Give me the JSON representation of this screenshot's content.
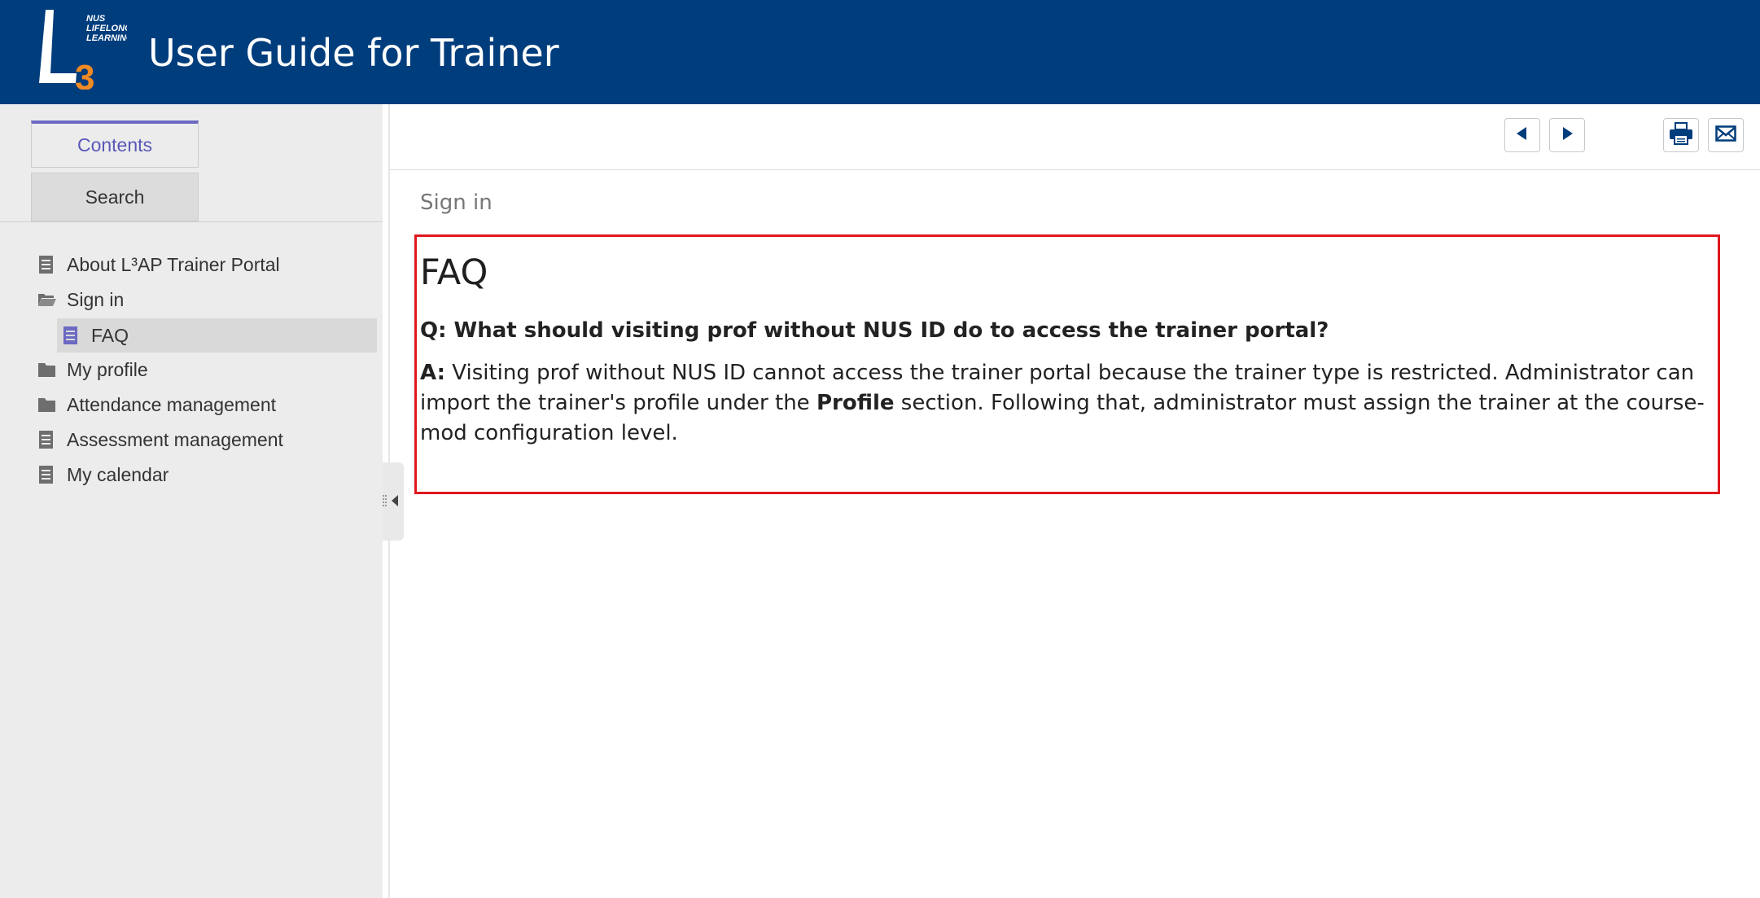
{
  "header": {
    "title": "User Guide for Trainer",
    "logo": {
      "big_letter": "L",
      "superscript": "3",
      "org_line1": "NUS",
      "org_line2": "LIFELONG",
      "org_line3": "LEARNING"
    }
  },
  "sidebar": {
    "tabs": [
      {
        "label": "Contents",
        "active": true
      },
      {
        "label": "Search",
        "active": false
      }
    ],
    "toc": [
      {
        "label": "About L³AP Trainer Portal",
        "icon": "page-icon",
        "level": 0
      },
      {
        "label": "Sign in",
        "icon": "folder-open-icon",
        "level": 0
      },
      {
        "label": "FAQ",
        "icon": "page-icon",
        "level": 1,
        "selected": true
      },
      {
        "label": "My profile",
        "icon": "folder-icon",
        "level": 0
      },
      {
        "label": "Attendance management",
        "icon": "folder-icon",
        "level": 0
      },
      {
        "label": "Assessment management",
        "icon": "page-icon",
        "level": 0
      },
      {
        "label": "My calendar",
        "icon": "page-icon",
        "level": 0
      }
    ]
  },
  "toolbar": {
    "buttons": [
      {
        "name": "previous-topic",
        "icon": "triangle-left-icon"
      },
      {
        "name": "next-topic",
        "icon": "triangle-right-icon"
      },
      {
        "name": "print",
        "icon": "printer-icon"
      },
      {
        "name": "email",
        "icon": "envelope-icon"
      }
    ]
  },
  "content": {
    "breadcrumb": "Sign in",
    "title": "FAQ",
    "question": "Q: What should visiting prof without NUS ID do to access the trainer portal?",
    "answer_prefix": "A:",
    "answer_part1": " Visiting prof without NUS ID cannot access the trainer portal because the trainer type is restricted. Administrator can import the trainer's profile under the ",
    "answer_bold": "Profile",
    "answer_part2": " section. Following that, administrator must assign the trainer at the course-mod configuration level."
  },
  "colors": {
    "header_bg": "#003d7c",
    "accent": "#6b69c2",
    "highlight_border": "#e0161e",
    "logo_orange": "#f08a24"
  }
}
